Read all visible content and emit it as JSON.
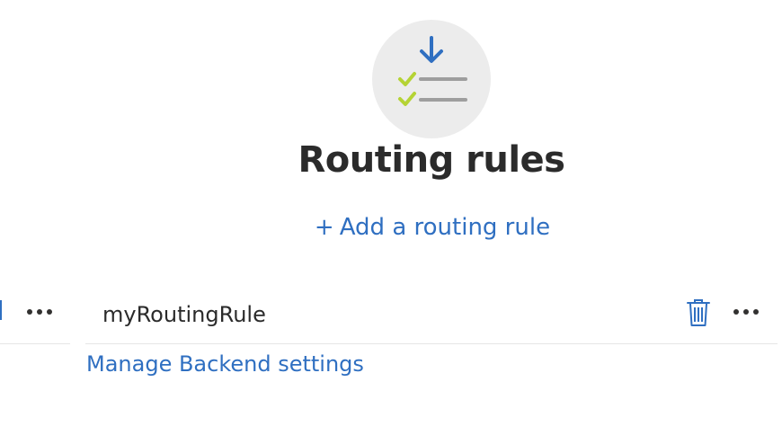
{
  "header": {
    "title": "Routing rules",
    "add_link_plus": "+",
    "add_link_label": "Add a routing rule"
  },
  "rules": [
    {
      "name": "myRoutingRule",
      "delete_icon": "trash-icon",
      "more_icon": "more-icon"
    }
  ],
  "links": {
    "manage_backend": "Manage Backend settings"
  },
  "icons": {
    "hero": "routing-rules-checklist-icon",
    "left_partial": "trash-icon",
    "left_more": "more-icon"
  },
  "colors": {
    "accent": "#2f6fc1",
    "check": "#b5d335",
    "arrow": "#2f6fc1",
    "line_gray": "#9e9e9e",
    "hero_bg": "#ececec",
    "divider": "#e6e6e6"
  }
}
